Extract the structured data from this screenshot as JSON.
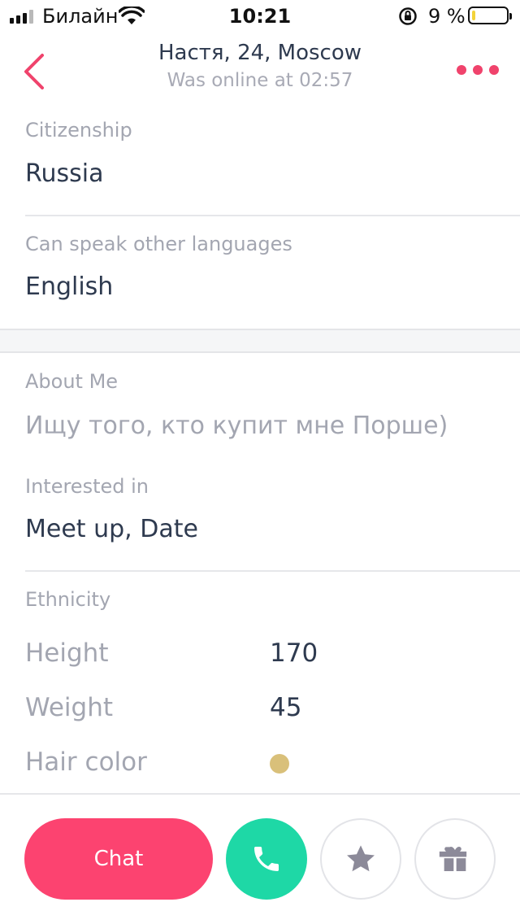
{
  "status_bar": {
    "carrier": "Билайн",
    "time": "10:21",
    "battery": "9 %",
    "battery_level": 0.09
  },
  "header": {
    "title": "Настя, 24, Moscow",
    "subtitle": "Was online at 02:57"
  },
  "profile": {
    "citizenship": {
      "label": "Citizenship",
      "value": "Russia"
    },
    "languages": {
      "label": "Can speak other languages",
      "value": "English"
    },
    "about": {
      "label": "About Me",
      "value": "Ищу того, кто купит мне Порше)"
    },
    "interested": {
      "label": "Interested in",
      "value": "Meet up, Date"
    },
    "ethnicity": {
      "label": "Ethnicity"
    },
    "height": {
      "label": "Height",
      "value": "170"
    },
    "weight": {
      "label": "Weight",
      "value": "45"
    },
    "hair_color": {
      "label": "Hair color",
      "color": "#d9c07a"
    }
  },
  "actions": {
    "chat_label": "Chat"
  },
  "icons": {
    "back": "chevron-left-icon",
    "more": "more-dots-icon",
    "call": "phone-icon",
    "favorite": "star-icon",
    "gift": "gift-icon"
  },
  "colors": {
    "accent": "#fc4370",
    "call": "#1ed8a6",
    "text_primary": "#2e3a4f",
    "text_secondary": "#a3a6b1"
  }
}
